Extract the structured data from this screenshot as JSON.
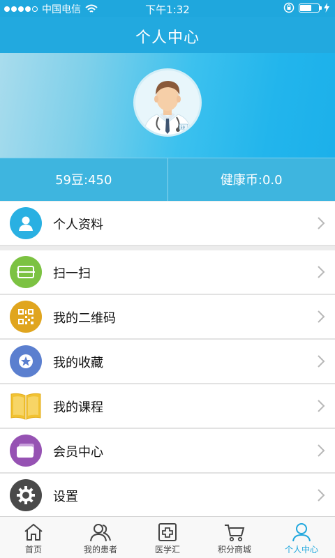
{
  "status_bar": {
    "carrier": "中国电信",
    "time": "下午1:32"
  },
  "header": {
    "title": "个人中心"
  },
  "stats": {
    "beans": "59豆:450",
    "coins": "健康币:0.0"
  },
  "menu": {
    "items": [
      {
        "label": "个人资料",
        "icon": "user-icon",
        "color": "#29b0e2"
      },
      {
        "label": "扫一扫",
        "icon": "scan-icon",
        "color": "#7cc242"
      },
      {
        "label": "我的二维码",
        "icon": "qrcode-icon",
        "color": "#e0a51f"
      },
      {
        "label": "我的收藏",
        "icon": "star-icon",
        "color": "#5b7fcf"
      },
      {
        "label": "我的课程",
        "icon": "book-icon",
        "color": "#f1c232"
      },
      {
        "label": "会员中心",
        "icon": "member-card-icon",
        "color": "#9652b3"
      },
      {
        "label": "设置",
        "icon": "gear-icon",
        "color": "#4a4a4a"
      }
    ]
  },
  "tabs": [
    {
      "label": "首页",
      "icon": "home-icon"
    },
    {
      "label": "我的患者",
      "icon": "patients-icon"
    },
    {
      "label": "医学汇",
      "icon": "medical-cross-icon"
    },
    {
      "label": "积分商城",
      "icon": "cart-icon"
    },
    {
      "label": "个人中心",
      "icon": "person-icon",
      "active": true
    }
  ],
  "colors": {
    "accent": "#1fa7dd",
    "stats_bg": "#3eb5df"
  }
}
